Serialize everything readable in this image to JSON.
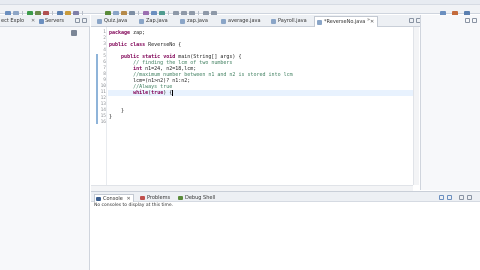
{
  "left_panel": {
    "tabs": [
      {
        "label": "ect Explo"
      },
      {
        "label": "Servers"
      }
    ]
  },
  "editor_tabs": [
    {
      "label": "Quiz.java"
    },
    {
      "label": "Zap.java"
    },
    {
      "label": "zap.java"
    },
    {
      "label": "average.java"
    },
    {
      "label": "Payroll.java"
    },
    {
      "label": "*ReverseNo.java",
      "active": true
    }
  ],
  "editor": {
    "lines": [
      {
        "num": "1",
        "text": "package zap;"
      },
      {
        "num": "2",
        "text": ""
      },
      {
        "num": "3",
        "text": "public class ReverseNo {"
      },
      {
        "num": "4",
        "text": ""
      },
      {
        "num": "5",
        "text": "    public static void main(String[] args) {"
      },
      {
        "num": "6",
        "text": "        // finding the lcm of two numbers"
      },
      {
        "num": "7",
        "text": "        int n1=24, n2=18,lcm;"
      },
      {
        "num": "8",
        "text": "        //maximum number between n1 and n2 is stored into lcm"
      },
      {
        "num": "9",
        "text": "        lcm=(n1>n2)? n1:n2;"
      },
      {
        "num": "10",
        "text": "        //Always true"
      },
      {
        "num": "11",
        "text": "        while(true) {"
      },
      {
        "num": "12",
        "text": ""
      },
      {
        "num": "13",
        "text": ""
      },
      {
        "num": "14",
        "text": "    }"
      },
      {
        "num": "15",
        "text": "}"
      },
      {
        "num": "16",
        "text": ""
      }
    ]
  },
  "console": {
    "tabs": [
      {
        "label": "Console",
        "active": true
      },
      {
        "label": "Problems"
      },
      {
        "label": "Debug Shell"
      }
    ],
    "message": "No consoles to display at this time."
  },
  "colors": {
    "keyword": "#7f0055",
    "comment": "#3f7f5f",
    "current_line": "#e8f2fe"
  }
}
